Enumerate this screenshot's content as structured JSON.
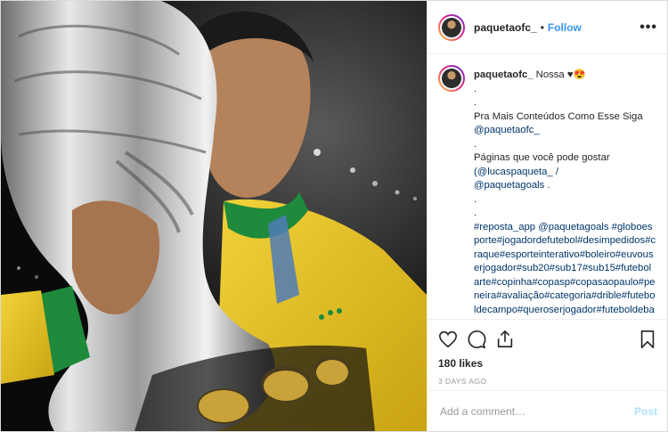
{
  "post": {
    "username": "paquetaofc_",
    "follow_label": "Follow",
    "caption": {
      "username": "paquetaofc_",
      "first_line": " Nossa ♥😍",
      "line_dot1": ".",
      "line_dot2": ".",
      "line_promo": "Pra Mais Conteúdos Como Esse Siga",
      "mention_main": "@paquetaofc_",
      "line_dot3": ".",
      "line_pages": "Páginas que você pode gostar",
      "mention_a": "(@lucaspaqueta_ /",
      "mention_b": "@paquetagoals .",
      "line_dot4": ".",
      "line_dot5": ".",
      "hashtags": "#reposta_app @paquetagoals #globoesporte#jogadordefutebol#desimpedidos#craque#esporteinterativo#boleiro#euvouserjogador#sub20#sub17#sub15#futebolarte#copinha#copasp#copasaopaulo#peneira#avaliação#categoria#drible#futeboldecampo#queroserjogador#futeboldebase#lucaspaquetá#paquete#paquetá#milanello#milanoto"
    },
    "likes": "180 likes",
    "time_ago": "3 DAYS AGO",
    "comment_placeholder": "Add a comment…",
    "post_label": "Post"
  },
  "icons": {
    "like": "heart-icon",
    "comment": "comment-icon",
    "share": "share-icon",
    "save": "bookmark-icon",
    "more": "more-options-icon"
  },
  "colors": {
    "link": "#3897f0",
    "post_disabled": "#b2dffc",
    "jersey_yellow": "#e6c21f",
    "jersey_green": "#1e8a3c"
  }
}
